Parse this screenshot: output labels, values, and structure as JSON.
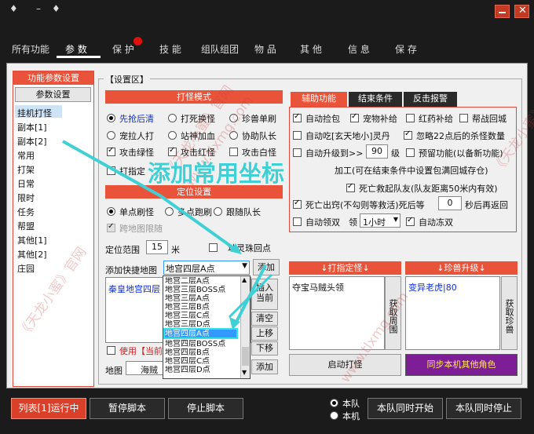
{
  "title_bar": {
    "glyphs": [
      "♦",
      "–",
      "♦"
    ],
    "minimize": "",
    "close": ""
  },
  "tabs": [
    "所有功能",
    "参 数",
    "保 护",
    "技 能",
    "组队组团",
    "物 品",
    "其 他",
    "信 息",
    "保 存"
  ],
  "sidebar": {
    "header": "功能参数设置",
    "button": "参数设置",
    "items": [
      "挂机打怪",
      "副本[1]",
      "副本[2]",
      "常用",
      "打架",
      "日常",
      "限时",
      "任务",
      "帮盟",
      "其他[1]",
      "其他[2]",
      "庄园"
    ]
  },
  "settings_area_title": "【设置区】",
  "kill_mode": {
    "header": "打怪模式",
    "options": [
      {
        "label": "先抢后清",
        "on": true
      },
      {
        "label": "打死换怪",
        "on": false
      },
      {
        "label": "珍兽单刷",
        "on": false
      },
      {
        "label": "宠拉人打",
        "on": false
      },
      {
        "label": "站神加血",
        "on": false
      },
      {
        "label": "协助队长",
        "on": false
      }
    ],
    "checks": [
      {
        "label": "攻击绿怪",
        "on": true
      },
      {
        "label": "攻击红怪",
        "on": true
      },
      {
        "label": "攻击白怪",
        "on": false
      },
      {
        "label": "打指定",
        "on": false
      }
    ]
  },
  "overlay_text": "添加常用坐标",
  "position": {
    "header": "定位设置",
    "options": [
      {
        "label": "单点刷怪",
        "on": true
      },
      {
        "label": "多点跑刷",
        "on": false
      },
      {
        "label": "跟随队长",
        "on": false
      }
    ],
    "cross_map": "跨地图限随",
    "range_label": "定位范围",
    "range_value": "15",
    "range_unit": "米",
    "spirit_point": "地灵珠回点",
    "quick_map_label": "添加快捷地图",
    "quick_map_value": "地宫四层A点",
    "add_button": "添加",
    "list_first": "秦皇地宫四层",
    "use_current": "使用【当前",
    "map_label": "地图",
    "map_value": "海贼",
    "side_buttons": [
      "插入当前",
      "清空",
      "上移",
      "下移",
      "添加"
    ]
  },
  "dropdown": {
    "items": [
      "地宫二层A点",
      "地宫三层BOSS点",
      "地宫三层A点",
      "地宫三层B点",
      "地宫三层C点",
      "地宫三层D点",
      "地宫四层A点",
      "地宫四层BOSS点",
      "地宫四层B点",
      "地宫四层C点",
      "地宫四层D点"
    ],
    "selected": "地宫四层A点"
  },
  "aux": {
    "tabs": [
      "辅助功能",
      "结束条件",
      "反击报警"
    ],
    "row1": [
      {
        "label": "自动捡包",
        "on": true
      },
      {
        "label": "宠物补给",
        "on": true
      },
      {
        "label": "红药补给",
        "on": false
      },
      {
        "label": "帮战回城",
        "on": false
      }
    ],
    "row2": [
      {
        "label": "自动吃[玄天地小]灵丹",
        "on": false
      },
      {
        "label": "忽略22点后的杀怪数量",
        "on": true
      }
    ],
    "row3_label": "自动升级到>>",
    "row3_value": "90",
    "row3_unit": "级",
    "row3_extra": "预留功能(以备新功能)",
    "row4": "加工(可在结束条件中设置包满回城存仓)",
    "row5": "死亡救起队友(队友距离50米内有效)",
    "row6_label": "死亡出窍(不勾则等救活)死后等",
    "row6_value": "0",
    "row6_unit": "秒后再返回",
    "row7_label": "自动领双",
    "row7_mid": "领",
    "row7_select": "1小时",
    "row7_extra": "自动冻双"
  },
  "hit_target": {
    "header": "↓打指定怪↓",
    "value": "夺宝马贼头领",
    "button": "获取周围"
  },
  "pet_upgrade": {
    "header": "↓珍兽升级↓",
    "value": "变异老虎|80",
    "button": "获取珍兽"
  },
  "start_button": "启动打怪",
  "sync_button": "同步本机其他角色",
  "bottom": {
    "list_button": "列表[1]运行中",
    "pause": "暂停脚本",
    "stop": "停止脚本",
    "radio1": "本队",
    "radio2": "本机",
    "team_start": "本队同时开始",
    "team_stop": "本队同时停止"
  },
  "watermarks": [
    "《天龙小蜜》官网",
    "www.tlxmg.com",
    "《天龙小蜜》官网",
    "www.tlxmg.com",
    "《天龙小蜜》官网"
  ],
  "colors": {
    "accent": "#e8533a",
    "overlay_text": "#3fd0d6",
    "sync_button": "#7d1e96",
    "list_button": "#d9402a"
  }
}
